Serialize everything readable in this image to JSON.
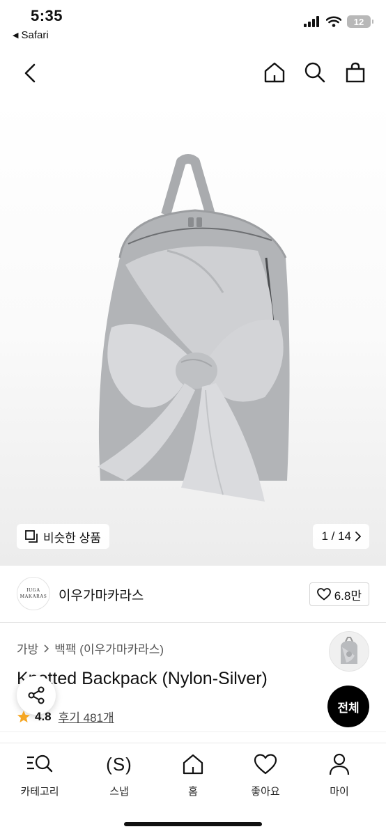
{
  "status_bar": {
    "time": "5:35",
    "back_app": "Safari",
    "battery": "12"
  },
  "nav": {
    "icons": [
      "back-chevron-icon",
      "home-icon",
      "search-icon",
      "shopping-bag-icon"
    ]
  },
  "hero": {
    "similar_label": "비슷한 상품",
    "pager": "1 / 14"
  },
  "brand": {
    "logo_line1": "IUGA",
    "logo_line2": "MAKARAS",
    "name": "이우가마카라스",
    "likes": "6.8만"
  },
  "product": {
    "breadcrumb": [
      "가방",
      "백팩 (이우가마카라스)"
    ],
    "title": "Knotted Backpack (Nylon-Silver)",
    "rating": "4.8",
    "reviews": "후기 481개",
    "all_button": "전체"
  },
  "tab_bar": {
    "items": [
      {
        "label": "카테고리",
        "icon": "category-search-icon"
      },
      {
        "label": "스냅",
        "icon": "snap-icon",
        "glyph": "(S)"
      },
      {
        "label": "홈",
        "icon": "home-icon"
      },
      {
        "label": "좋아요",
        "icon": "heart-icon"
      },
      {
        "label": "마이",
        "icon": "person-icon"
      }
    ]
  },
  "colors": {
    "accent_star": "#f5a623",
    "black": "#000000"
  }
}
